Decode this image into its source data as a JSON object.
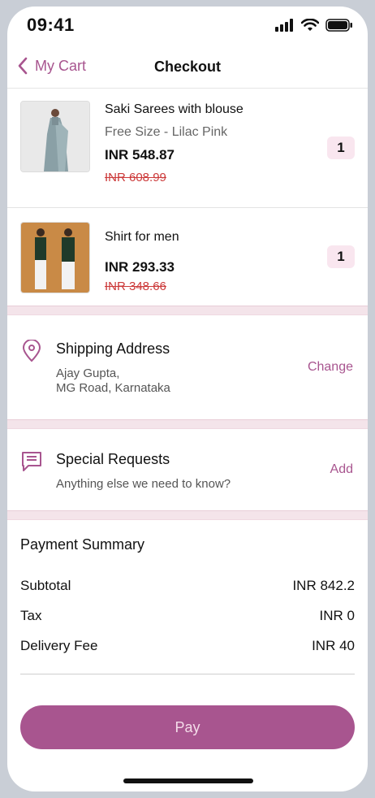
{
  "status_bar": {
    "time": "09:41"
  },
  "nav": {
    "back_label": "My Cart",
    "title": "Checkout"
  },
  "items": [
    {
      "name": "Saki Sarees with blouse",
      "variant": "Free Size - Lilac Pink",
      "price": "INR 548.87",
      "old_price": "INR 608.99",
      "qty": "1"
    },
    {
      "name": "Shirt for men",
      "variant": "",
      "price": "INR 293.33",
      "old_price": "INR 348.66",
      "qty": "1"
    }
  ],
  "shipping": {
    "title": "Shipping Address",
    "line1": "Ajay Gupta,",
    "line2": "MG Road, Karnataka",
    "action": "Change"
  },
  "special": {
    "title": "Special Requests",
    "subtitle": "Anything else we need to know?",
    "action": "Add"
  },
  "summary": {
    "title": "Payment Summary",
    "rows": [
      {
        "label": "Subtotal",
        "value": "INR 842.2"
      },
      {
        "label": "Tax",
        "value": "INR 0"
      },
      {
        "label": "Delivery Fee",
        "value": "INR 40"
      }
    ]
  },
  "pay_button": {
    "label": "Pay"
  },
  "colors": {
    "accent": "#a8558f",
    "strike": "#cc3a3a",
    "qty_bg": "#f9e6ef",
    "separator": "#f4e4ea"
  },
  "icons": [
    "signal-icon",
    "wifi-icon",
    "battery-icon",
    "chevron-left-icon",
    "location-pin-icon",
    "message-icon"
  ]
}
